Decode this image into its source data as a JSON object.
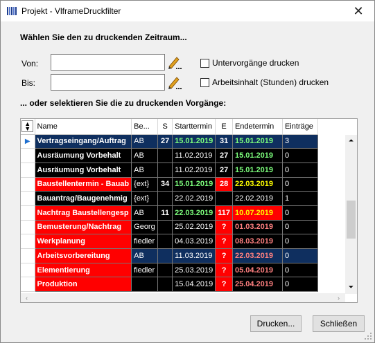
{
  "window": {
    "title": "Projekt - VlframeDruckfilter"
  },
  "form": {
    "heading": "Wählen Sie den zu druckenden Zeitraum...",
    "von_label": "Von:",
    "bis_label": "Bis:",
    "von_value": "",
    "bis_value": "",
    "untervorgaenge_label": "Untervorgänge drucken",
    "arbeitsinhalt_label": "Arbeitsinhalt (Stunden) drucken",
    "subheading": "... oder selektieren Sie die zu druckenden Vorgänge:"
  },
  "grid": {
    "columns": [
      "Name",
      "Be...",
      "S",
      "Starttermin",
      "E",
      "Endetermin",
      "Einträge"
    ],
    "rows": [
      {
        "name": "Vertragseingang/Auftrag",
        "be": "AB",
        "s": "27",
        "start": "15.01.2019",
        "e": "31",
        "end": "15.01.2019",
        "eintraege": "3",
        "selected": true,
        "bg": {
          "name": "#0f2f5f",
          "be": "#0f2f5f",
          "s": "#0f2f5f",
          "start": "#0f2f5f",
          "e": "#0f2f5f",
          "end": "#0f2f5f",
          "ein": "#0f2f5f"
        },
        "fg": {
          "start": "#7dff7d",
          "end": "#7dff7d"
        }
      },
      {
        "name": "Ausräumung Vorbehalt",
        "be": "AB",
        "s": "",
        "start": "11.02.2019",
        "e": "27",
        "end": "15.01.2019",
        "eintraege": "0",
        "bg": {
          "name": "#000000",
          "be": "#000000",
          "s": "#000000",
          "start": "#000000",
          "e": "#000000",
          "end": "#000000",
          "ein": "#000000"
        },
        "fg": {
          "end": "#7dff7d"
        }
      },
      {
        "name": "Ausräumung Vorbehalt",
        "be": "AB",
        "s": "",
        "start": "11.02.2019",
        "e": "27",
        "end": "15.01.2019",
        "eintraege": "0",
        "bg": {
          "name": "#000000",
          "be": "#000000",
          "s": "#000000",
          "start": "#000000",
          "e": "#000000",
          "end": "#000000",
          "ein": "#000000"
        },
        "fg": {
          "end": "#7dff7d"
        }
      },
      {
        "name": "Baustellentermin - Bauab",
        "be": "{ext}",
        "s": "34",
        "start": "15.01.2019",
        "e": "28",
        "end": "22.03.2019",
        "eintraege": "0",
        "bg": {
          "name": "#ff0000",
          "be": "#000000",
          "s": "#000000",
          "start": "#000000",
          "e": "#ff0000",
          "end": "#000000",
          "ein": "#000000"
        },
        "fg": {
          "start": "#7dff7d",
          "end": "#ffff00"
        }
      },
      {
        "name": "Bauantrag/Baugenehmig",
        "be": "{ext}",
        "s": "",
        "start": "22.02.2019",
        "e": "",
        "end": "22.02.2019",
        "eintraege": "1",
        "bg": {
          "name": "#000000",
          "be": "#000000",
          "s": "#000000",
          "start": "#000000",
          "e": "#000000",
          "end": "#000000",
          "ein": "#000000"
        },
        "fg": {}
      },
      {
        "name": "Nachtrag Baustellengesp",
        "be": "AB",
        "s": "11",
        "start": "22.03.2019",
        "e": "117",
        "end": "10.07.2019",
        "eintraege": "0",
        "bg": {
          "name": "#ff0000",
          "be": "#000000",
          "s": "#000000",
          "start": "#000000",
          "e": "#ff0000",
          "end": "#ff0000",
          "ein": "#000000"
        },
        "fg": {
          "start": "#7dff7d",
          "end": "#ffff00"
        }
      },
      {
        "name": "Bemusterung/Nachtrag",
        "be": "Georg",
        "s": "",
        "start": "25.02.2019",
        "e": "?",
        "end": "01.03.2019",
        "eintraege": "0",
        "bg": {
          "name": "#ff0000",
          "be": "#000000",
          "s": "#000000",
          "start": "#000000",
          "e": "#ff0000",
          "end": "#000000",
          "ein": "#000000"
        },
        "fg": {
          "end": "#ff8080"
        }
      },
      {
        "name": "Werkplanung",
        "be": "fiedler",
        "s": "",
        "start": "04.03.2019",
        "e": "?",
        "end": "08.03.2019",
        "eintraege": "0",
        "bg": {
          "name": "#ff0000",
          "be": "#000000",
          "s": "#000000",
          "start": "#000000",
          "e": "#ff0000",
          "end": "#000000",
          "ein": "#000000"
        },
        "fg": {
          "end": "#ff8080"
        }
      },
      {
        "name": "Arbeitsvorbereitung",
        "be": "AB",
        "s": "",
        "start": "11.03.2019",
        "e": "?",
        "end": "22.03.2019",
        "eintraege": "0",
        "bg": {
          "name": "#ff0000",
          "be": "#0f2f5f",
          "s": "#0f2f5f",
          "start": "#0f2f5f",
          "e": "#ff0000",
          "end": "#0f2f5f",
          "ein": "#0f2f5f"
        },
        "fg": {
          "end": "#ff8080"
        }
      },
      {
        "name": "Elementierung",
        "be": "fiedler",
        "s": "",
        "start": "25.03.2019",
        "e": "?",
        "end": "05.04.2019",
        "eintraege": "0",
        "bg": {
          "name": "#ff0000",
          "be": "#000000",
          "s": "#000000",
          "start": "#000000",
          "e": "#ff0000",
          "end": "#000000",
          "ein": "#000000"
        },
        "fg": {
          "end": "#ff8080"
        }
      },
      {
        "name": "Produktion",
        "be": "",
        "s": "",
        "start": "15.04.2019",
        "e": "?",
        "end": "25.04.2019",
        "eintraege": "0",
        "bg": {
          "name": "#ff0000",
          "be": "#000000",
          "s": "#000000",
          "start": "#000000",
          "e": "#ff0000",
          "end": "#000000",
          "ein": "#000000"
        },
        "fg": {
          "end": "#ff8080"
        }
      }
    ]
  },
  "buttons": {
    "print": "Drucken...",
    "close": "Schließen"
  },
  "icons": {
    "app": "project-app-icon",
    "close": "close-icon",
    "pencil": "pencil-icon",
    "sort": "sort-updown-icon",
    "row_pointer": "row-pointer-icon"
  }
}
